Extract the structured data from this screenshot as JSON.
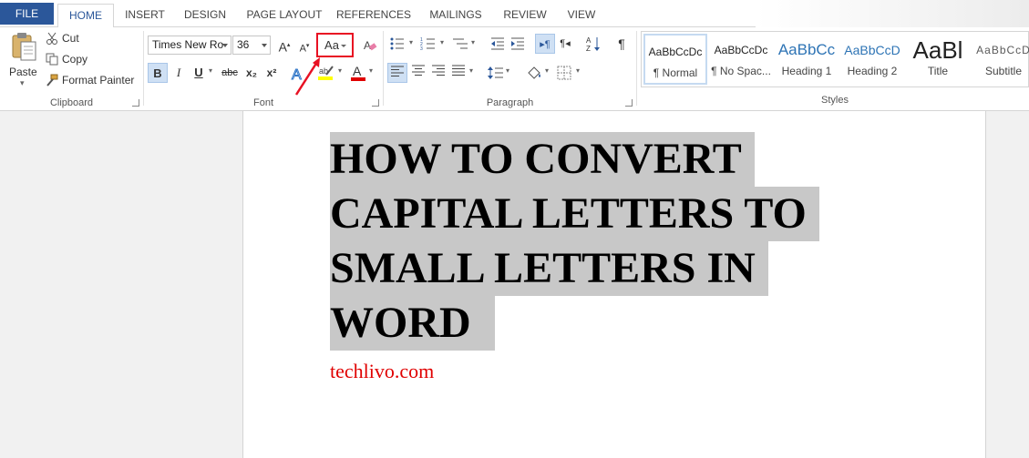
{
  "tabs": {
    "file": "FILE",
    "home": "HOME",
    "insert": "INSERT",
    "design": "DESIGN",
    "page_layout": "PAGE LAYOUT",
    "references": "REFERENCES",
    "mailings": "MAILINGS",
    "review": "REVIEW",
    "view": "VIEW"
  },
  "clipboard": {
    "paste": "Paste",
    "cut": "Cut",
    "copy": "Copy",
    "format_painter": "Format Painter",
    "label": "Clipboard"
  },
  "font": {
    "name": "Times New Ro",
    "size": "36",
    "change_case": "Aa",
    "label": "Font",
    "bold": "B",
    "italic": "I",
    "underline": "U",
    "strikethrough": "abc",
    "subscript": "x₂",
    "superscript": "x²"
  },
  "paragraph": {
    "label": "Paragraph"
  },
  "styles": {
    "label": "Styles",
    "items": [
      {
        "preview": "AaBbCcDc",
        "name": "¶ Normal"
      },
      {
        "preview": "AaBbCcDc",
        "name": "¶ No Spac..."
      },
      {
        "preview": "AaBbCc",
        "name": "Heading 1"
      },
      {
        "preview": "AaBbCcD",
        "name": "Heading 2"
      },
      {
        "preview": "AaBl",
        "name": "Title"
      },
      {
        "preview": "AaBbCcD",
        "name": "Subtitle"
      }
    ]
  },
  "document": {
    "title_lines": [
      "HOW TO CONVERT",
      "CAPITAL LETTERS TO",
      "SMALL LETTERS IN",
      "WORD"
    ],
    "site": "techlivo.com"
  },
  "colors": {
    "file_tab": "#2b579a",
    "annotation": "#e81123",
    "selection": "#c8c8c8",
    "site_text": "#e00000"
  }
}
